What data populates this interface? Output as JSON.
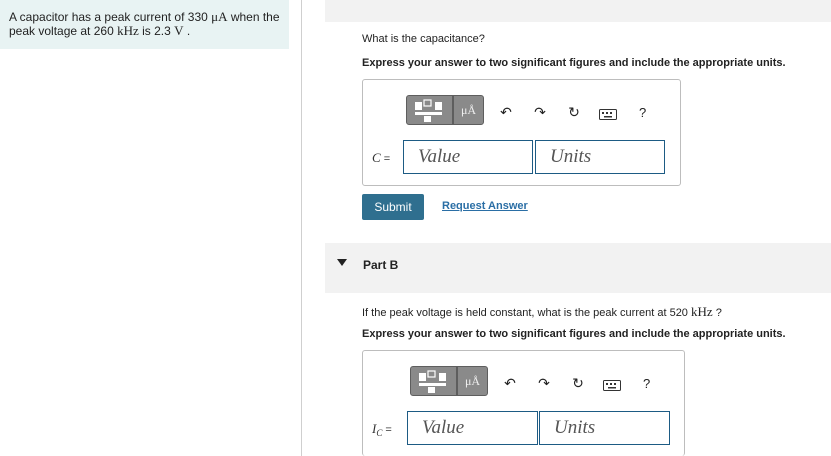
{
  "problem": {
    "part1": "A capacitor has a peak current of 330 ",
    "unit_current": "μA",
    "part2": " when the peak voltage at 260 ",
    "unit_freq": "kHz",
    "part3": " is 2.3 ",
    "unit_volt": "V",
    "part4": " ."
  },
  "partA": {
    "question": "What is the capacitance?",
    "instruction": "Express your answer to two significant figures and include the appropriate units.",
    "toolbar": {
      "units_label": "μÅ",
      "help": "?"
    },
    "variable": "C",
    "equals": "=",
    "value_placeholder": "Value",
    "units_placeholder": "Units",
    "submit": "Submit",
    "request": "Request Answer"
  },
  "partB": {
    "title": "Part B",
    "question_pre": "If the peak voltage is held constant, what is the peak current at 520 ",
    "question_unit": "kHz",
    "question_post": " ?",
    "instruction": "Express your answer to two significant figures and include the appropriate units.",
    "toolbar": {
      "units_label": "μÅ",
      "help": "?"
    },
    "variable": "I",
    "variable_sub": "C",
    "equals": "=",
    "value_placeholder": "Value",
    "units_placeholder": "Units"
  }
}
